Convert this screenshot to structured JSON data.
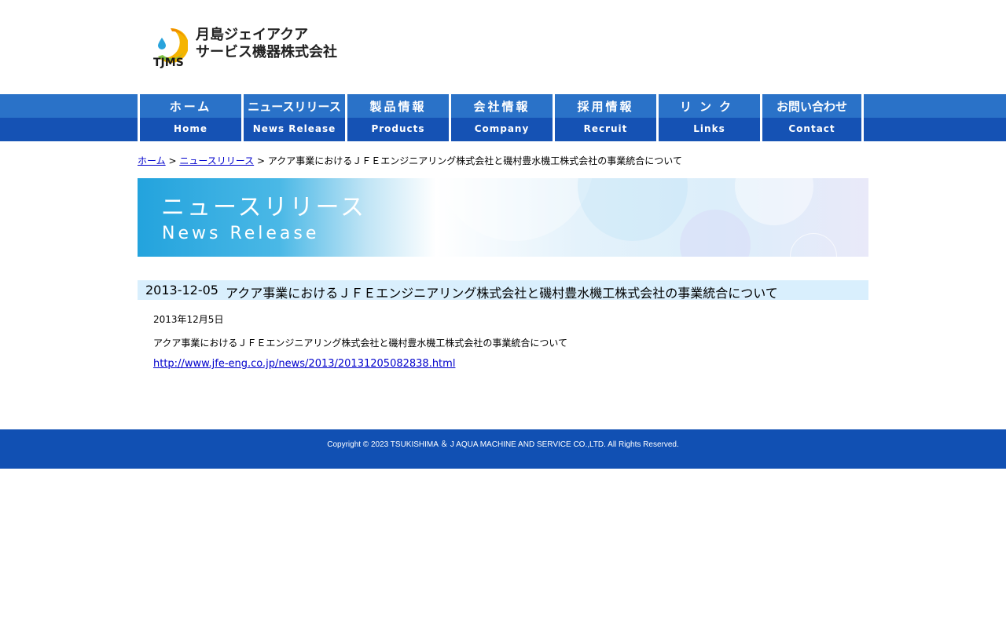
{
  "header": {
    "logo_abbr": "TJMS",
    "logo_name_line1": "月島ジェイアクア",
    "logo_name_line2": "サービス機器株式会社"
  },
  "nav": {
    "items": [
      {
        "jp": "ホーム",
        "en": "Home"
      },
      {
        "jp": "ニュースリリース",
        "en": "News Release"
      },
      {
        "jp": "製品情報",
        "en": "Products"
      },
      {
        "jp": "会社情報",
        "en": "Company"
      },
      {
        "jp": "採用情報",
        "en": "Recruit"
      },
      {
        "jp": "リンク",
        "en": "Links"
      },
      {
        "jp": "お問い合わせ",
        "en": "Contact"
      }
    ]
  },
  "breadcrumb": {
    "home": "ホーム",
    "sep1": " > ",
    "news": "ニュースリリース",
    "sep2": " > ",
    "current": "アクア事業におけるＪＦＥエンジニアリング株式会社と磯村豊水機工株式会社の事業統合について"
  },
  "banner": {
    "title_jp": "ニュースリリース",
    "title_en": "News Release"
  },
  "article": {
    "date": "2013-12-05",
    "title": "アクア事業におけるＪＦＥエンジニアリング株式会社と磯村豊水機工株式会社の事業統合について",
    "body_date": "2013年12月5日",
    "body_text": "アクア事業におけるＪＦＥエンジニアリング株式会社と磯村豊水機工株式会社の事業統合について",
    "link": "http://www.jfe-eng.co.jp/news/2013/20131205082838.html"
  },
  "footer": {
    "copyright": "Copyright © 2023 TSUKISHIMA ＆ J AQUA MACHINE AND SERVICE CO.,LTD. All Rights Reserved."
  },
  "colors": {
    "nav_top": "#2a72c8",
    "nav_bottom": "#1552b4",
    "footer": "#1150b3",
    "title_bar": "#d9effd",
    "link": "#0000cc"
  }
}
